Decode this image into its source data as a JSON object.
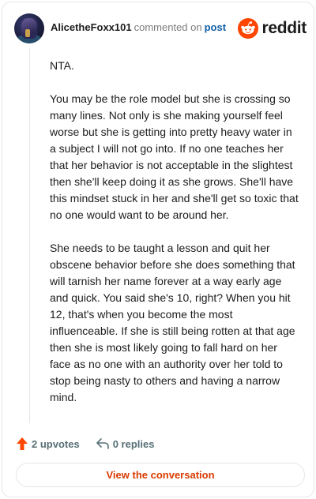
{
  "comment": {
    "username": "AlicetheFoxx101",
    "action_text": "commented on",
    "post_link": "post",
    "paragraphs": [
      "NTA.",
      "You may be the role model but she is crossing so many lines. Not only is she making yourself feel worse but she is getting into pretty heavy water in a subject I will not go into. If no one teaches her that her behavior is not acceptable in the slightest then she'll keep doing it as she grows. She'll have this mindset stuck in her and she'll get so toxic that no one would want to be around her.",
      "She needs to be taught a lesson and quit her obscene behavior before she does something that will tarnish her name forever at a way early age and quick. You said she's 10, right? When you hit 12, that's when you become the most influenceable. If she is still being rotten at that age then she is most likely going to fall hard on her face as no one with an authority over her told to stop being nasty to others and having a narrow mind."
    ],
    "upvotes": "2 upvotes",
    "replies": "0 replies",
    "cta": "View the conversation"
  },
  "brand": {
    "name": "reddit",
    "color": "#ff4500",
    "icon": "reddit-logo-icon"
  },
  "icons": {
    "upvote": "upvote-arrow-icon",
    "reply": "reply-arrow-icon"
  },
  "colors": {
    "upvote": "#ff4500",
    "link": "#0f5ea8",
    "cta": "#d93a00"
  }
}
